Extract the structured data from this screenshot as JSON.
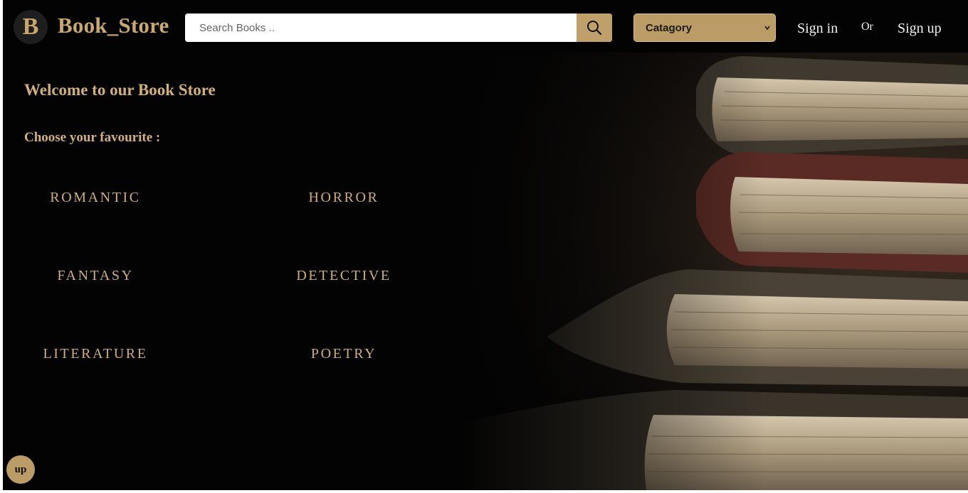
{
  "header": {
    "logo_letter": "B",
    "brand": "Book_Store",
    "search_placeholder": "Search Books ..",
    "category_label": "Catagory",
    "sign_in": "Sign in",
    "or": "Or",
    "sign_up": "Sign up"
  },
  "hero": {
    "welcome": "Welcome to our Book Store",
    "choose": "Choose your favourite :",
    "categories": [
      "ROMANTIC",
      "HORROR",
      "FANTASY",
      "DETECTIVE",
      "LITERATURE",
      "POETRY"
    ]
  },
  "up_button": "up",
  "colors": {
    "accent": "#c9a86f",
    "background": "#030303",
    "button": "#bc9c66"
  },
  "icons": [
    "logo-icon",
    "search-icon",
    "chevron-down-icon"
  ]
}
